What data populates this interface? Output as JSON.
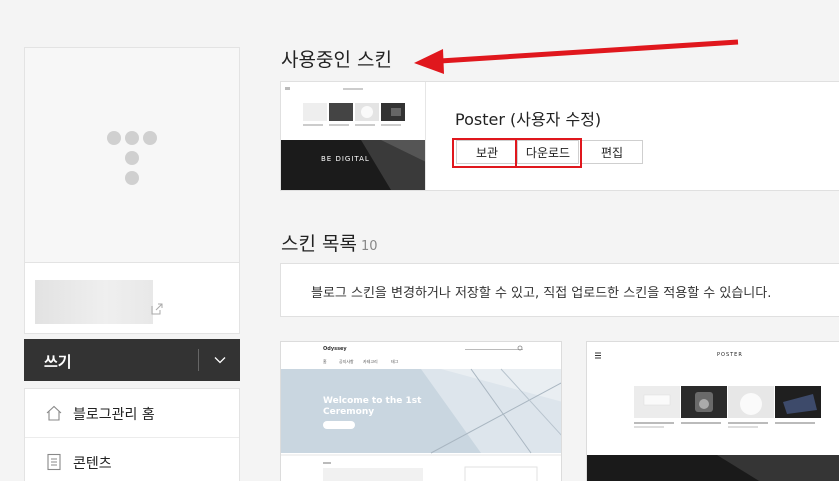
{
  "sidebar": {
    "write_label": "쓰기",
    "menu": [
      {
        "label": "블로그관리 홈",
        "icon": "home-icon"
      },
      {
        "label": "콘텐츠",
        "icon": "document-icon"
      }
    ]
  },
  "current_skin": {
    "section_title": "사용중인 스킨",
    "name": "Poster (사용자 수정)",
    "buttons": {
      "keep": "보관",
      "download": "다운로드",
      "edit": "편집"
    },
    "thumbnail": {
      "tagline": "BE DIGITAL"
    }
  },
  "skin_list": {
    "section_title": "스킨 목록",
    "count": "10",
    "info": "블로그 스킨을 변경하거나 저장할 수 있고, 직접 업로드한 스킨을 적용할 수 있습니다.",
    "cards": [
      {
        "brand": "Odyssey",
        "hero": "Welcome to the 1st Ceremony",
        "nav": [
          "홈",
          "공지사항",
          "카테고리",
          "태그"
        ]
      },
      {
        "brand": "POSTER"
      }
    ]
  },
  "annotation_color": "#e0171d"
}
